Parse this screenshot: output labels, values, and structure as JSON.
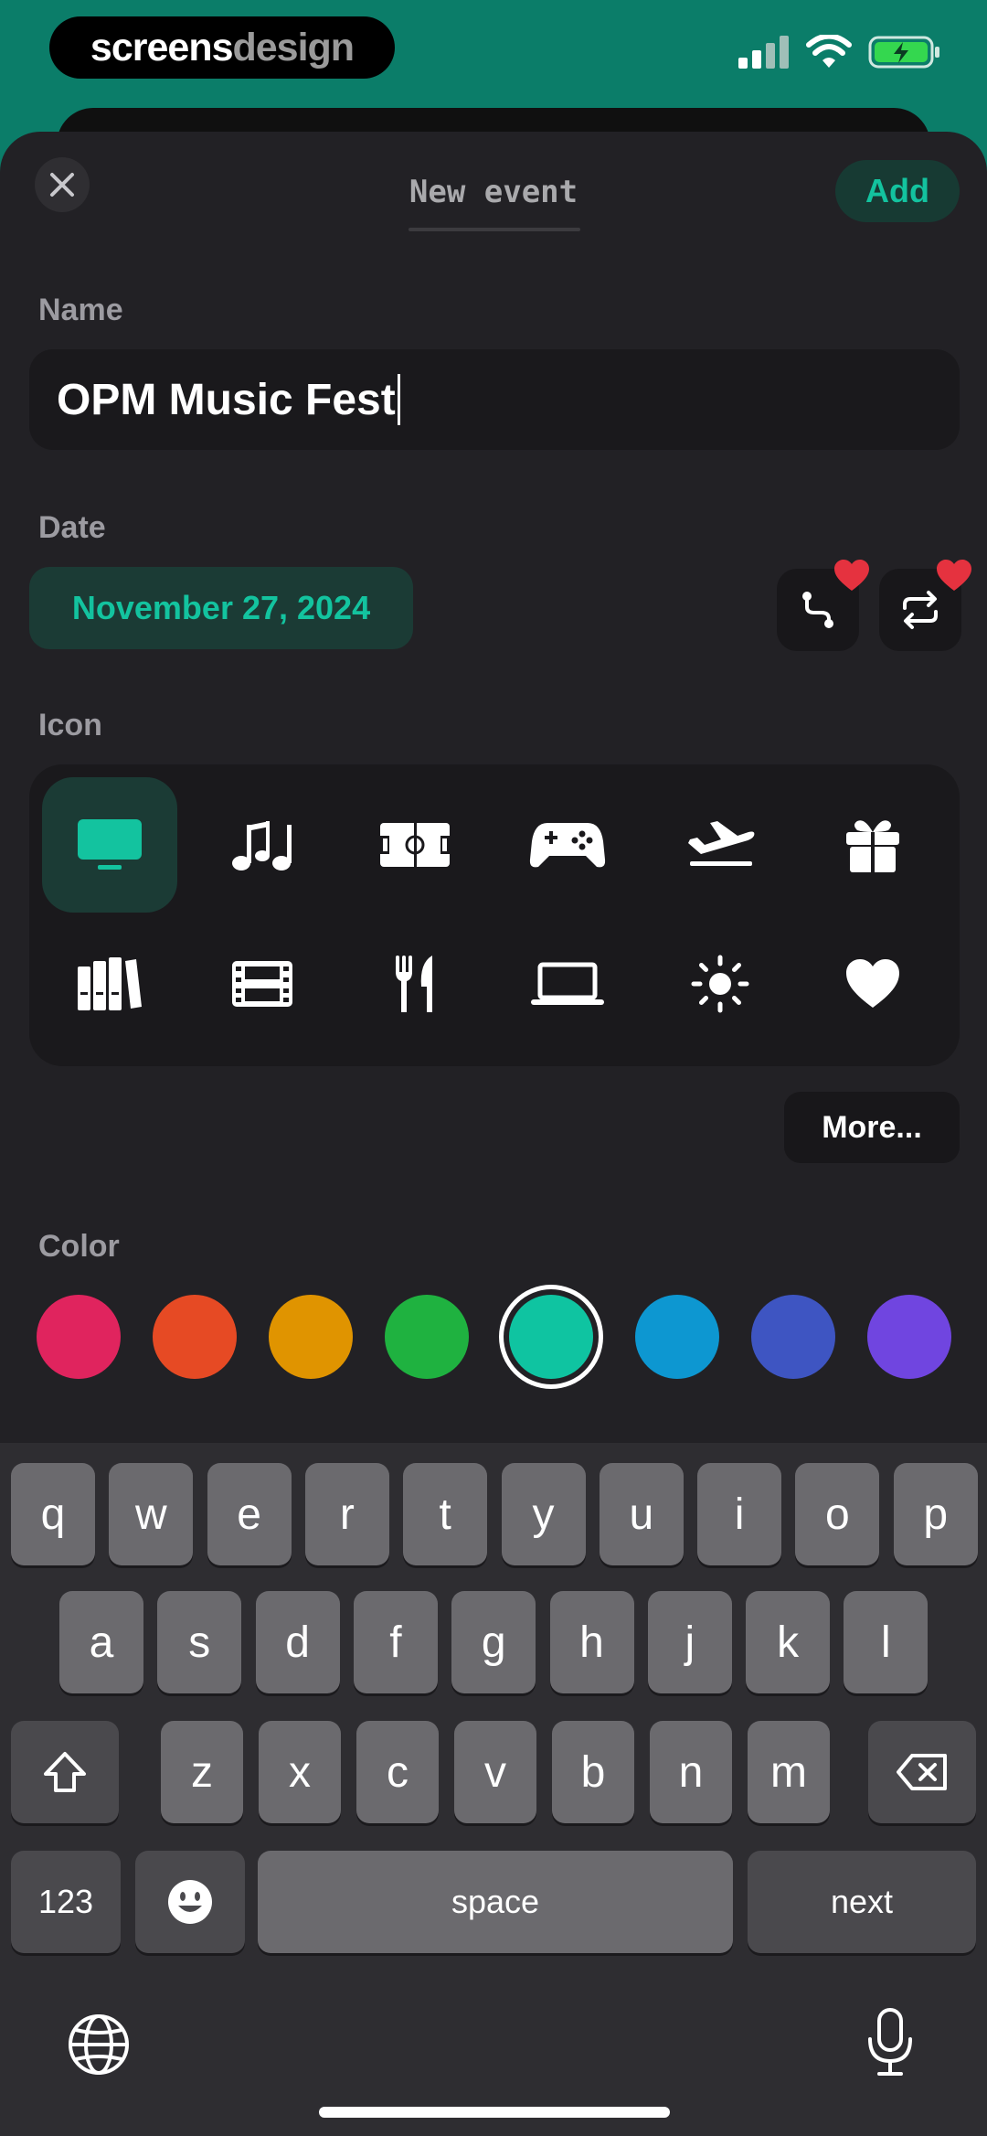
{
  "status_bar": {
    "brand_part1": "screens",
    "brand_part2": "design"
  },
  "header": {
    "title": "New event",
    "add_label": "Add"
  },
  "name_section": {
    "label": "Name",
    "value": "OPM Music Fest"
  },
  "date_section": {
    "label": "Date",
    "value": "November 27, 2024",
    "badge_colors": "#e5323f"
  },
  "icon_section": {
    "label": "Icon",
    "icons": [
      "tv-icon",
      "music-notes-icon",
      "stadium-icon",
      "gamepad-icon",
      "airplane-icon",
      "gift-icon",
      "books-icon",
      "film-icon",
      "fork-knife-icon",
      "laptop-icon",
      "sun-icon",
      "heart-icon"
    ],
    "selected": "tv-icon",
    "more_label": "More..."
  },
  "color_section": {
    "label": "Color",
    "colors": [
      "#e0245e",
      "#e64a24",
      "#e09400",
      "#1fb240",
      "#0fc4a1",
      "#0d97d1",
      "#3e55c2",
      "#7045e0"
    ],
    "selected": "#0fc4a1"
  },
  "keyboard": {
    "row1": [
      "q",
      "w",
      "e",
      "r",
      "t",
      "y",
      "u",
      "i",
      "o",
      "p"
    ],
    "row2": [
      "a",
      "s",
      "d",
      "f",
      "g",
      "h",
      "j",
      "k",
      "l"
    ],
    "row3": [
      "z",
      "x",
      "c",
      "v",
      "b",
      "n",
      "m"
    ],
    "numbers_label": "123",
    "space_label": "space",
    "return_label": "next"
  },
  "theme": {
    "accent": "#13c39f",
    "background": "#222125",
    "status_bar_bg": "#0b7d69"
  }
}
